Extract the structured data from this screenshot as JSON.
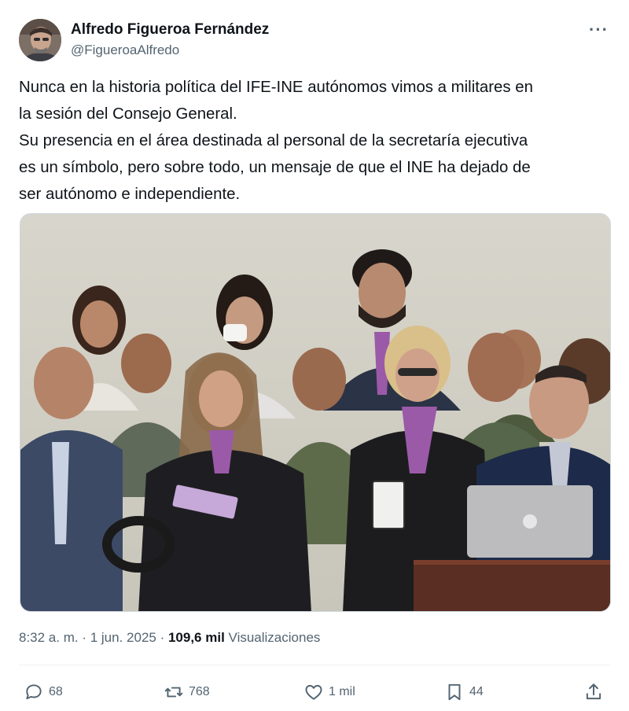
{
  "author": {
    "display_name": "Alfredo Figueroa Fernández",
    "handle": "@FigueroaAlfredo"
  },
  "more_menu": {
    "icon": "more-dots-icon",
    "label": "···"
  },
  "tweet": {
    "lines": [
      "Nunca en la historia política del IFE-INE autónomos vimos a militares en",
      "la sesión del Consejo General.",
      "Su presencia en el área destinada al personal de la secretaría ejecutiva",
      "es un símbolo, pero sobre todo, un mensaje de que el INE ha dejado de",
      "ser autónomo e independiente."
    ]
  },
  "meta": {
    "time": "8:32 a. m.",
    "separator": " · ",
    "date": "1 jun. 2025",
    "views_count": "109,6 mil",
    "views_label": "Visualizaciones"
  },
  "actions": {
    "replies": {
      "icon": "reply-icon",
      "count": "68"
    },
    "reposts": {
      "icon": "repost-icon",
      "count": "768"
    },
    "likes": {
      "icon": "like-icon",
      "count": "1 mil"
    },
    "bookmarks": {
      "icon": "bookmark-icon",
      "count": "44"
    },
    "share": {
      "icon": "share-icon"
    }
  },
  "colors": {
    "text": "#0f1419",
    "secondary": "#536471",
    "border": "#cfd9de",
    "scarf": "#9b5aa8"
  }
}
